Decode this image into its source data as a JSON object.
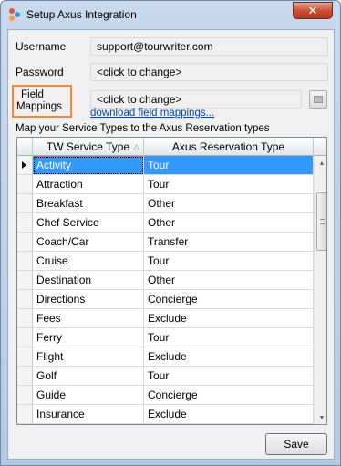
{
  "window": {
    "title": "Setup Axus Integration",
    "close_glyph": "✕"
  },
  "form": {
    "username_label": "Username",
    "username_value": "support@tourwriter.com",
    "password_label": "Password",
    "password_value": "<click to change>",
    "field_mappings_label_line1": "Field",
    "field_mappings_label_line2": "Mappings",
    "field_mappings_value": "<click to change>",
    "download_link": "download field mappings...",
    "caption": "Map your Service Types to the Axus Reservation types"
  },
  "grid": {
    "columns": [
      "TW Service Type",
      "Axus Reservation Type"
    ],
    "rows": [
      {
        "service": "Activity",
        "axus": "Tour",
        "selected": true
      },
      {
        "service": "Attraction",
        "axus": "Tour"
      },
      {
        "service": "Breakfast",
        "axus": "Other"
      },
      {
        "service": "Chef Service",
        "axus": "Other"
      },
      {
        "service": "Coach/Car",
        "axus": "Transfer"
      },
      {
        "service": "Cruise",
        "axus": "Tour"
      },
      {
        "service": "Destination",
        "axus": "Other"
      },
      {
        "service": "Directions",
        "axus": "Concierge"
      },
      {
        "service": "Fees",
        "axus": "Exclude"
      },
      {
        "service": "Ferry",
        "axus": "Tour"
      },
      {
        "service": "Flight",
        "axus": "Exclude"
      },
      {
        "service": "Golf",
        "axus": "Tour"
      },
      {
        "service": "Guide",
        "axus": "Concierge"
      },
      {
        "service": "Insurance",
        "axus": "Exclude"
      }
    ]
  },
  "buttons": {
    "save_label": "Save"
  },
  "icons": {
    "app": "axus-logo-icon",
    "close": "close-icon",
    "browse": "browse-icon",
    "sort": "sort-triangle-icon",
    "row_indicator": "current-row-icon"
  },
  "colors": {
    "selection": "#3399ff",
    "highlight_border": "#f2883a",
    "link": "#0645ad"
  }
}
